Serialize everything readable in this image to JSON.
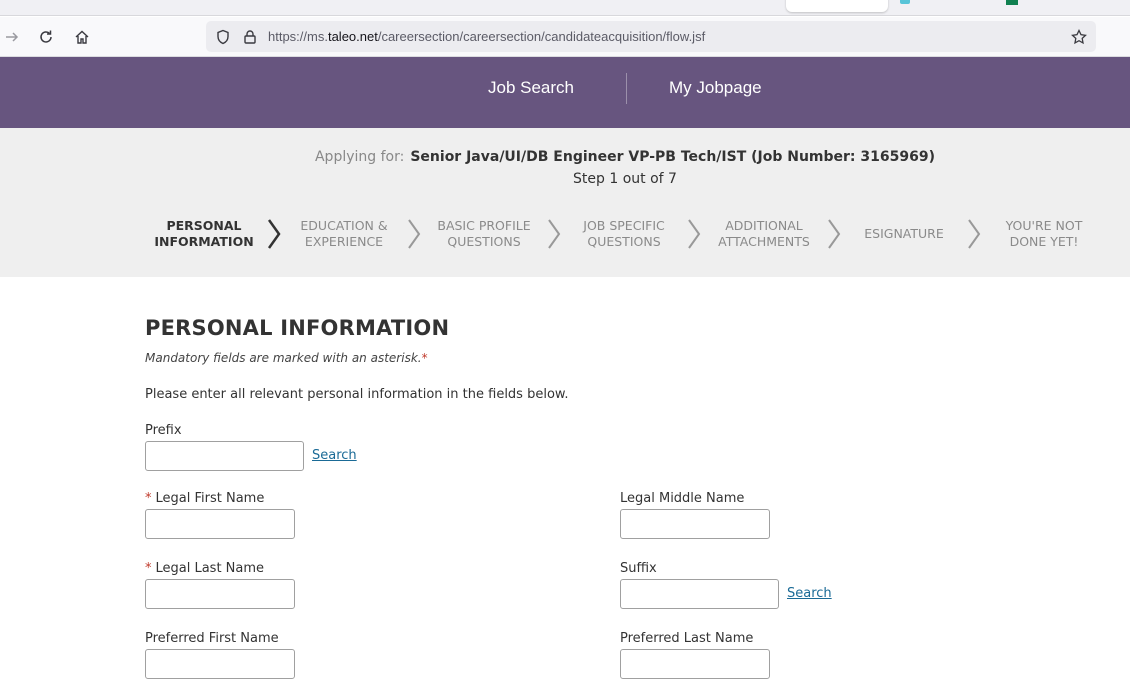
{
  "browser": {
    "url_prefix": "https://ms.",
    "url_host": "taleo.net",
    "url_path": "/careersection/careersection/candidateacquisition/flow.jsf"
  },
  "header": {
    "nav": [
      {
        "label": "Job Search"
      },
      {
        "label": "My Jobpage"
      }
    ]
  },
  "apply": {
    "applying_label": "Applying for:",
    "job_title": "Senior Java/UI/DB Engineer VP-PB Tech/IST (Job Number: 3165969)",
    "step_text": "Step 1 out of 7",
    "steps": [
      {
        "line1": "PERSONAL",
        "line2": "INFORMATION"
      },
      {
        "line1": "EDUCATION &",
        "line2": "EXPERIENCE"
      },
      {
        "line1": "BASIC PROFILE",
        "line2": "QUESTIONS"
      },
      {
        "line1": "JOB SPECIFIC",
        "line2": "QUESTIONS"
      },
      {
        "line1": "ADDITIONAL",
        "line2": "ATTACHMENTS"
      },
      {
        "line1": "ESIGNATURE",
        "line2": ""
      },
      {
        "line1": "YOU'RE NOT",
        "line2": "DONE YET!"
      }
    ],
    "current_step": 1,
    "total_steps": 7
  },
  "form": {
    "title": "PERSONAL INFORMATION",
    "mandatory_note": "Mandatory fields are marked with an asterisk.",
    "required_marker": "*",
    "intro": "Please enter all relevant personal information in the fields below.",
    "search_label": "Search",
    "fields": {
      "prefix": {
        "label": "Prefix",
        "value": ""
      },
      "first_name": {
        "label": "Legal First Name",
        "value": "",
        "required": true
      },
      "middle_name": {
        "label": "Legal Middle Name",
        "value": ""
      },
      "last_name": {
        "label": "Legal Last Name",
        "value": "",
        "required": true
      },
      "suffix": {
        "label": "Suffix",
        "value": ""
      },
      "pref_first": {
        "label": "Preferred First Name",
        "value": ""
      },
      "pref_last": {
        "label": "Preferred Last Name",
        "value": ""
      }
    }
  },
  "colors": {
    "header_bg": "#67557f",
    "band_bg": "#efefef",
    "link": "#1a6a96",
    "required": "#c0392b"
  },
  "icons": [
    "forward-arrow-icon",
    "reload-icon",
    "home-icon",
    "shield-icon",
    "lock-icon",
    "bookmark-star-icon",
    "chevron-right-icon"
  ]
}
